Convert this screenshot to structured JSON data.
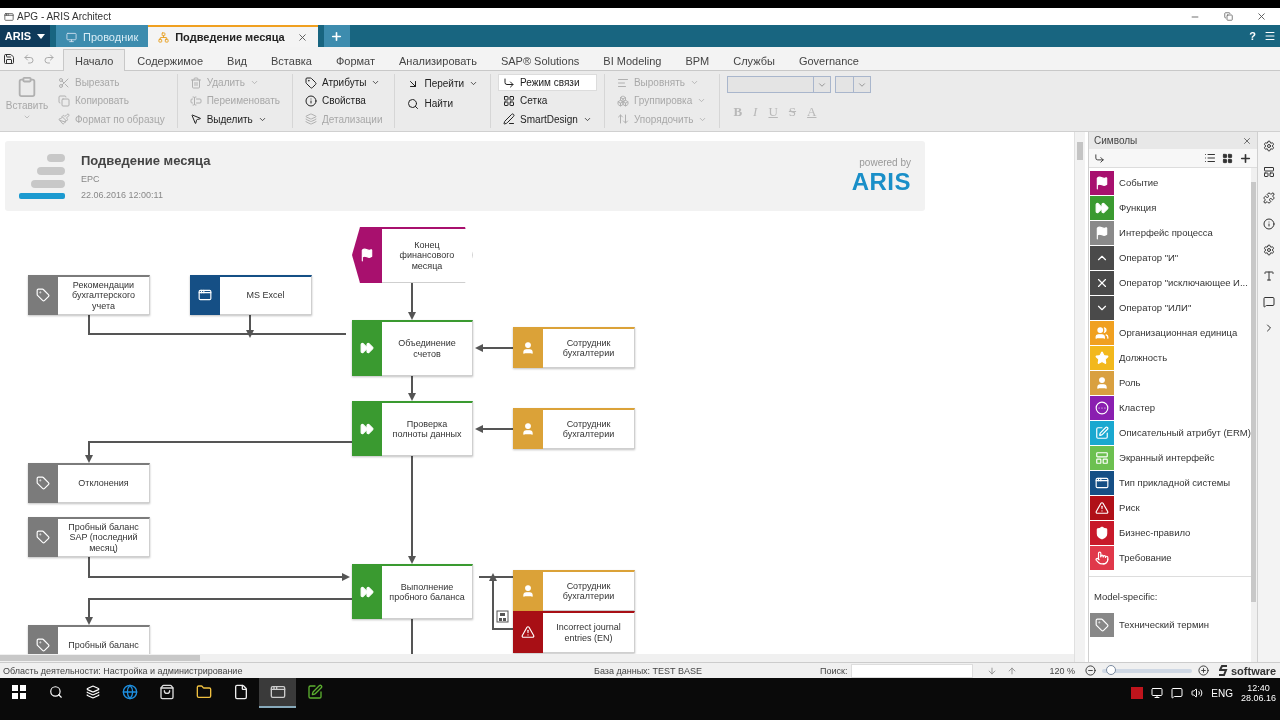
{
  "window": {
    "title": "APG - ARIS Architect"
  },
  "tab_bar": {
    "menu": "ARIS",
    "help": "?",
    "tabs": [
      {
        "label": "Проводник",
        "selected": false
      },
      {
        "label": "Подведение месяца",
        "selected": true
      }
    ]
  },
  "ribbon_tabs": [
    {
      "label": "Начало",
      "selected": true
    },
    {
      "label": "Содержимое",
      "selected": false
    },
    {
      "label": "Вид",
      "selected": false
    },
    {
      "label": "Вставка",
      "selected": false
    },
    {
      "label": "Формат",
      "selected": false
    },
    {
      "label": "Анализировать",
      "selected": false
    },
    {
      "label": "SAP® Solutions",
      "selected": false
    },
    {
      "label": "BI Modeling",
      "selected": false
    },
    {
      "label": "BPM",
      "selected": false
    },
    {
      "label": "Службы",
      "selected": false
    },
    {
      "label": "Governance",
      "selected": false
    }
  ],
  "ribbon_groups": [
    {
      "items": [
        {
          "kind": "large",
          "label": "Вставить",
          "disabled": true,
          "dropdown": true
        },
        {
          "kind": "small",
          "label": "Вырезать",
          "disabled": true,
          "dropdown": false
        },
        {
          "kind": "small",
          "label": "Копировать",
          "disabled": true,
          "dropdown": false
        },
        {
          "kind": "small",
          "label": "Формат по образцу",
          "disabled": true,
          "dropdown": false
        }
      ]
    },
    {
      "items": [
        {
          "kind": "small",
          "label": "Удалить",
          "disabled": true,
          "dropdown": true
        },
        {
          "kind": "small",
          "label": "Переименовать",
          "disabled": true,
          "dropdown": false
        },
        {
          "kind": "small",
          "label": "Выделить",
          "disabled": false,
          "dropdown": true
        }
      ]
    },
    {
      "items": [
        {
          "kind": "small",
          "label": "Атрибуты",
          "disabled": false,
          "dropdown": true
        },
        {
          "kind": "small",
          "label": "Свойства",
          "disabled": false,
          "dropdown": false
        },
        {
          "kind": "small",
          "label": "Детализации",
          "disabled": true,
          "dropdown": false
        }
      ]
    },
    {
      "items": [
        {
          "kind": "small",
          "label": "Перейти",
          "disabled": false,
          "dropdown": true
        },
        {
          "kind": "small",
          "label": "Найти",
          "disabled": false,
          "dropdown": false
        }
      ]
    },
    {
      "items": [
        {
          "kind": "small",
          "label": "Режим связи",
          "disabled": false,
          "dropdown": false,
          "on": true
        },
        {
          "kind": "small",
          "label": "Сетка",
          "disabled": false,
          "dropdown": false,
          "on": false
        },
        {
          "kind": "small",
          "label": "SmartDesign",
          "disabled": false,
          "dropdown": true,
          "on": false
        }
      ]
    },
    {
      "items": [
        {
          "kind": "small",
          "label": "Выровнять",
          "disabled": true,
          "dropdown": true
        },
        {
          "kind": "small",
          "label": "Группировка",
          "disabled": true,
          "dropdown": true
        },
        {
          "kind": "small",
          "label": "Упорядочить",
          "disabled": true,
          "dropdown": true
        }
      ]
    }
  ],
  "font_group": {
    "disabled": true,
    "format_buttons": [
      "B",
      "I",
      "U",
      "S",
      "A"
    ]
  },
  "model_header": {
    "title": "Подведение месяца",
    "type": "EPC",
    "date": "22.06.2016 12:00:11",
    "powered_by": "powered by",
    "logo": "ARIS"
  },
  "diagram": {
    "nodes": [
      {
        "kind": "event",
        "label": "Конец финансового месяца"
      },
      {
        "kind": "document",
        "label": "Рекомендации бухгалтерского учета"
      },
      {
        "kind": "system",
        "label": "MS Excel"
      },
      {
        "kind": "function",
        "label": "Объединение счетов"
      },
      {
        "kind": "role",
        "label": "Сотрудник бухгалтерии"
      },
      {
        "kind": "function",
        "label": "Проверка полноты данных"
      },
      {
        "kind": "role",
        "label": "Сотрудник бухгалтерии"
      },
      {
        "kind": "document",
        "label": "Отклонения"
      },
      {
        "kind": "document",
        "label": "Пробный баланс SAP (последний месяц)"
      },
      {
        "kind": "function",
        "label": "Выполнение пробного баланса"
      },
      {
        "kind": "role",
        "label": "Сотрудник бухгалтерии"
      },
      {
        "kind": "risk",
        "label": "Incorrect journal entries (EN)"
      },
      {
        "kind": "document",
        "label": "Пробный баланс"
      }
    ]
  },
  "symbols": {
    "title": "Символы",
    "items": [
      {
        "kind": "event",
        "label": "Событие",
        "color": "#a8106e"
      },
      {
        "kind": "function",
        "label": "Функция",
        "color": "#3a9a30"
      },
      {
        "kind": "interface",
        "label": "Интерфейс процесса",
        "color": "#8a8a8a"
      },
      {
        "kind": "and",
        "label": "Оператор \"И\"",
        "color": "#4a4a4a"
      },
      {
        "kind": "xor",
        "label": "Оператор \"исключающее И...",
        "color": "#4a4a4a"
      },
      {
        "kind": "or",
        "label": "Оператор \"ИЛИ\"",
        "color": "#4a4a4a"
      },
      {
        "kind": "orgunit",
        "label": "Организационная единица",
        "color": "#f0a020"
      },
      {
        "kind": "position",
        "label": "Должность",
        "color": "#f2b81c"
      },
      {
        "kind": "role",
        "label": "Роль",
        "color": "#d9a040"
      },
      {
        "kind": "cluster",
        "label": "Кластер",
        "color": "#8a1fb0"
      },
      {
        "kind": "attribute",
        "label": "Описательный атрибут (ERM)",
        "color": "#1aa8d0"
      },
      {
        "kind": "screen",
        "label": "Экранный интерфейс",
        "color": "#6cc050"
      },
      {
        "kind": "system",
        "label": "Тип прикладной системы",
        "color": "#154f85"
      },
      {
        "kind": "risk",
        "label": "Риск",
        "color": "#b01018"
      },
      {
        "kind": "rule",
        "label": "Бизнес-правило",
        "color": "#c8192a"
      },
      {
        "kind": "requirement",
        "label": "Требование",
        "color": "#e0384a"
      }
    ],
    "section": "Model-specific:",
    "section_items": [
      {
        "kind": "term",
        "label": "Технический термин",
        "color": "#888888"
      }
    ]
  },
  "status_bar": {
    "area": "Область деятельности: Настройка и администрирование",
    "database": "База данных: TEST BASE",
    "search_label": "Поиск:",
    "zoom": "120 %",
    "zoom_slider": {
      "level": 0.1
    },
    "brand": "software"
  },
  "taskbar": {
    "apps": [
      {
        "selected": false
      },
      {
        "selected": false
      },
      {
        "selected": false
      },
      {
        "selected": false
      },
      {
        "selected": true
      },
      {
        "selected": false
      }
    ],
    "language": "ENG",
    "time": "12:40",
    "date": "28.06.16"
  }
}
